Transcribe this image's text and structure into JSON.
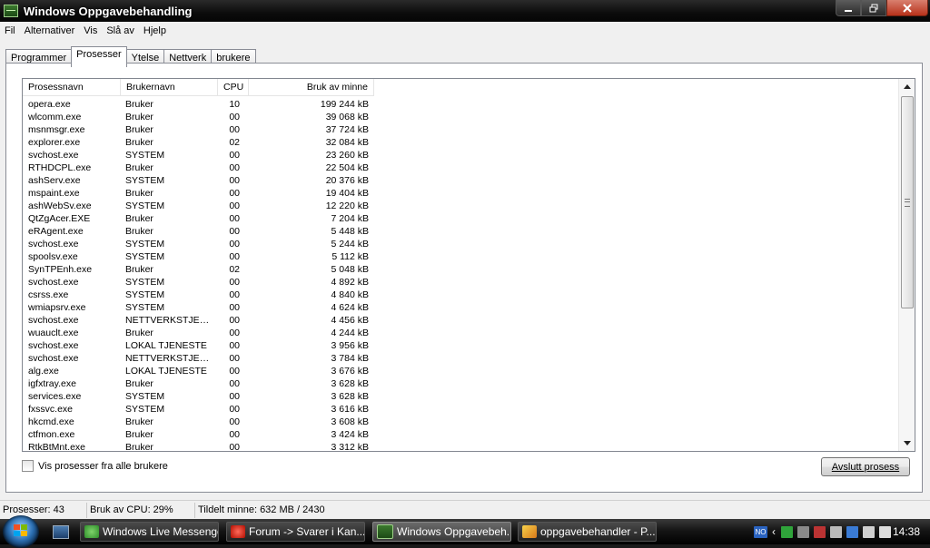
{
  "window": {
    "title": "Windows Oppgavebehandling"
  },
  "menu": [
    "Fil",
    "Alternativer",
    "Vis",
    "Slå av",
    "Hjelp"
  ],
  "tabs": [
    {
      "label": "Programmer",
      "active": false
    },
    {
      "label": "Prosesser",
      "active": true
    },
    {
      "label": "Ytelse",
      "active": false
    },
    {
      "label": "Nettverk",
      "active": false
    },
    {
      "label": "brukere",
      "active": false
    }
  ],
  "columns": [
    "Prosessnavn",
    "Brukernavn",
    "CPU",
    "Bruk av minne"
  ],
  "processes": [
    [
      "opera.exe",
      "Bruker",
      "10",
      "199 244 kB"
    ],
    [
      "wlcomm.exe",
      "Bruker",
      "00",
      "39 068 kB"
    ],
    [
      "msnmsgr.exe",
      "Bruker",
      "00",
      "37 724 kB"
    ],
    [
      "explorer.exe",
      "Bruker",
      "02",
      "32 084 kB"
    ],
    [
      "svchost.exe",
      "SYSTEM",
      "00",
      "23 260 kB"
    ],
    [
      "RTHDCPL.exe",
      "Bruker",
      "00",
      "22 504 kB"
    ],
    [
      "ashServ.exe",
      "SYSTEM",
      "00",
      "20 376 kB"
    ],
    [
      "mspaint.exe",
      "Bruker",
      "00",
      "19 404 kB"
    ],
    [
      "ashWebSv.exe",
      "SYSTEM",
      "00",
      "12 220 kB"
    ],
    [
      "QtZgAcer.EXE",
      "Bruker",
      "00",
      "7 204 kB"
    ],
    [
      "eRAgent.exe",
      "Bruker",
      "00",
      "5 448 kB"
    ],
    [
      "svchost.exe",
      "SYSTEM",
      "00",
      "5 244 kB"
    ],
    [
      "spoolsv.exe",
      "SYSTEM",
      "00",
      "5 112 kB"
    ],
    [
      "SynTPEnh.exe",
      "Bruker",
      "02",
      "5 048 kB"
    ],
    [
      "svchost.exe",
      "SYSTEM",
      "00",
      "4 892 kB"
    ],
    [
      "csrss.exe",
      "SYSTEM",
      "00",
      "4 840 kB"
    ],
    [
      "wmiapsrv.exe",
      "SYSTEM",
      "00",
      "4 624 kB"
    ],
    [
      "svchost.exe",
      "NETTVERKSTJEN...",
      "00",
      "4 456 kB"
    ],
    [
      "wuauclt.exe",
      "Bruker",
      "00",
      "4 244 kB"
    ],
    [
      "svchost.exe",
      "LOKAL TJENESTE",
      "00",
      "3 956 kB"
    ],
    [
      "svchost.exe",
      "NETTVERKSTJEN...",
      "00",
      "3 784 kB"
    ],
    [
      "alg.exe",
      "LOKAL TJENESTE",
      "00",
      "3 676 kB"
    ],
    [
      "igfxtray.exe",
      "Bruker",
      "00",
      "3 628 kB"
    ],
    [
      "services.exe",
      "SYSTEM",
      "00",
      "3 628 kB"
    ],
    [
      "fxssvc.exe",
      "SYSTEM",
      "00",
      "3 616 kB"
    ],
    [
      "hkcmd.exe",
      "Bruker",
      "00",
      "3 608 kB"
    ],
    [
      "ctfmon.exe",
      "Bruker",
      "00",
      "3 424 kB"
    ],
    [
      "RtkBtMnt.exe",
      "Bruker",
      "00",
      "3 312 kB"
    ]
  ],
  "show_all_label": "Vis prosesser fra alle brukere",
  "show_all_checked": false,
  "end_process_label": "Avslutt prosess",
  "status": {
    "processes": "Prosesser: 43",
    "cpu": "Bruk av CPU: 29%",
    "memory": "Tildelt minne: 632 MB / 2430"
  },
  "taskbar": {
    "tasks": [
      {
        "label": "Windows Live Messenger",
        "icon": "messenger-icon",
        "active": false
      },
      {
        "label": "Forum -> Svarer i Kan...",
        "icon": "opera-icon",
        "active": false
      },
      {
        "label": "Windows Oppgavebeh...",
        "icon": "task-manager-icon",
        "active": true
      },
      {
        "label": "oppgavebehandler - P...",
        "icon": "paint-icon",
        "active": false
      }
    ],
    "tray_language": "NO",
    "clock": "14:38"
  }
}
